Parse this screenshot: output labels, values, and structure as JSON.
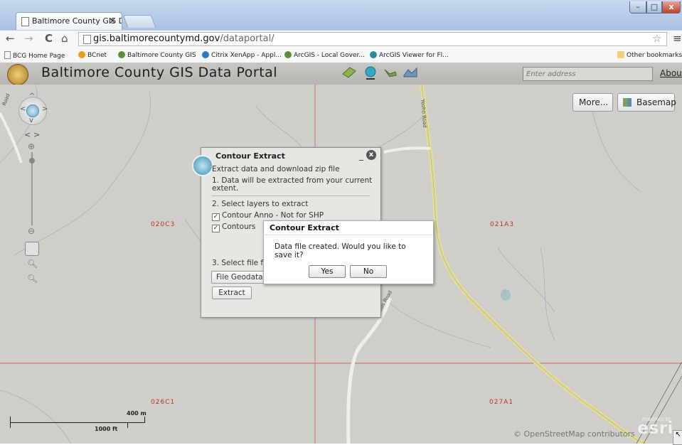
{
  "browser": {
    "tab_title": "Baltimore County GIS Dat",
    "tab_close": "×",
    "url_host": "gis.baltimorecountymd.gov",
    "url_path": "/dataportal/",
    "window_buttons": {
      "minimize": "–",
      "maximize": "□",
      "close": "x"
    },
    "nav": {
      "back": "←",
      "forward": "→",
      "reload": "C",
      "home": "⌂",
      "star": "☆",
      "menu": "≡"
    },
    "bookmarks": [
      {
        "label": "BCG Home Page",
        "icon_color": "#ffffff"
      },
      {
        "label": "BCnet",
        "icon_color": "#e8a019"
      },
      {
        "label": "Baltimore County GIS",
        "icon_color": "#5a8f3b"
      },
      {
        "label": "Citrix XenApp - Appl...",
        "icon_color": "#2c7cc4"
      },
      {
        "label": "ArcGIS - Local Gover...",
        "icon_color": "#5a8f3b"
      },
      {
        "label": "ArcGIS Viewer for Fl...",
        "icon_color": "#2d8a9e"
      }
    ],
    "other_bookmarks": "Other bookmarks"
  },
  "app": {
    "title": "Baltimore County GIS Data Portal",
    "address_placeholder": "Enter address",
    "about_label": "About",
    "more_label": "More...",
    "basemap_label": "Basemap"
  },
  "map": {
    "grid_labels": [
      "020C3",
      "021A3",
      "026C1",
      "027A1"
    ],
    "road_labels": [
      "Yeoho Road",
      "Dubbs Road",
      "Road"
    ],
    "scale": {
      "metric": "400 m",
      "imperial": "1000 ft"
    },
    "attribution": "© OpenStreetMap contributors",
    "esri": "esri",
    "powered_by": "POWERED BY"
  },
  "contour_panel": {
    "title": "Contour Extract",
    "minimize": "_",
    "close": "x",
    "intro": "Extract data and download zip file",
    "step1_line1": "1. Data will be extracted from your current",
    "step1_line2": "extent.",
    "step2": "2. Select layers to extract",
    "layers": [
      {
        "label": "Contour Anno - Not for SHP",
        "checked": true
      },
      {
        "label": "Contours",
        "checked": true
      }
    ],
    "step3": "3. Select file fo",
    "format_value": "File Geodatab",
    "extract_label": "Extract"
  },
  "modal": {
    "title": "Contour Extract",
    "message": "Data file created. Would you like to save it?",
    "yes_label": "Yes",
    "no_label": "No"
  }
}
